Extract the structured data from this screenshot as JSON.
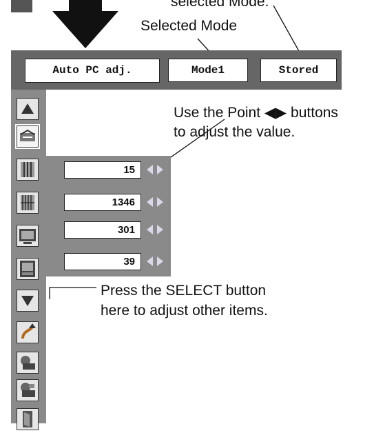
{
  "annotations": {
    "stored_caption_fragment": "selected Mode.",
    "selected_mode": "Selected Mode",
    "point_buttons_line1": "Use the Point ◀▶ buttons",
    "point_buttons_line2": "to adjust the value.",
    "select_line1": "Press the SELECT button",
    "select_line2": "here to adjust other items."
  },
  "top_bar": {
    "title": "Auto PC adj.",
    "mode": "Mode1",
    "status": "Stored"
  },
  "values": [
    "15",
    "1346",
    "301",
    "39"
  ],
  "sidebar_icons": [
    "up-arrow-icon",
    "auto-pc-adjust-icon",
    "fine-sync-icon",
    "total-dots-icon",
    "horizontal-position-icon",
    "vertical-position-icon",
    "down-arrow-icon",
    "reset-icon",
    "mode-free-icon",
    "store-icon",
    "quit-icon"
  ],
  "colors": {
    "panel_gray": "#8a8a8a",
    "bar_gray": "#666666",
    "arrow_light": "#d8d8e8"
  }
}
